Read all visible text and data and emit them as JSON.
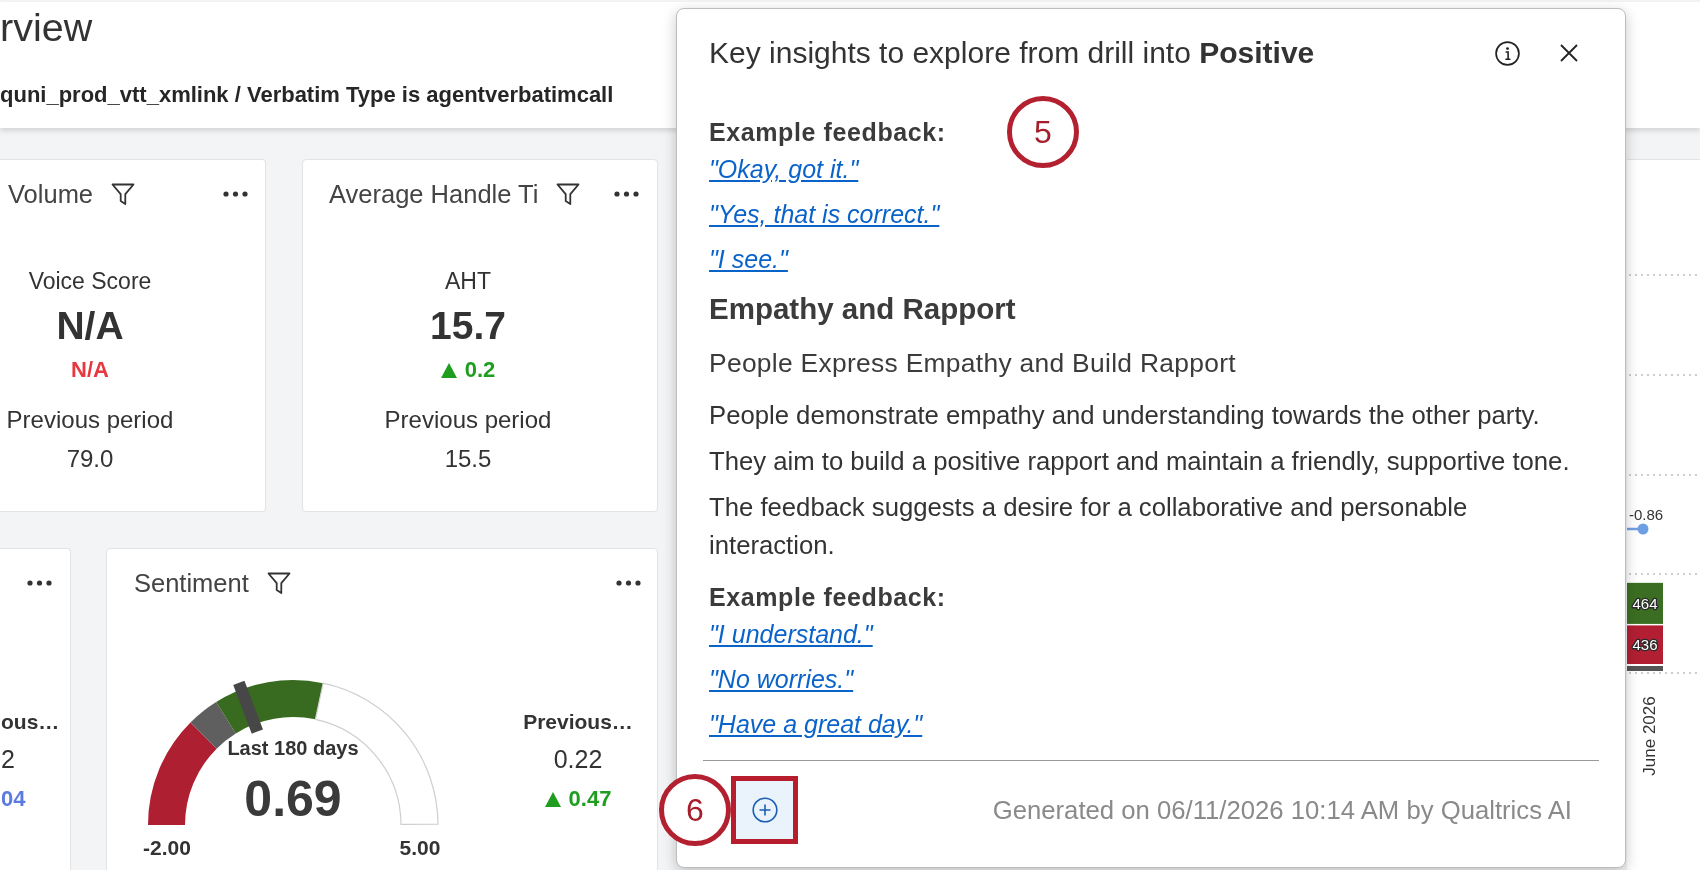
{
  "header": {
    "title": "rview",
    "subtitle": "quni_prod_vtt_xmlink / Verbatim Type is agentverbatimcall"
  },
  "widgets": [
    {
      "kind": "metric",
      "title": "Volume",
      "metric_label": "Voice Score",
      "value": "N/A",
      "change": {
        "text": "N/A",
        "up": false,
        "color": "#e5393f"
      },
      "previous_label": "Previous period",
      "previous_value": "79.0"
    },
    {
      "kind": "metric",
      "title": "Average Handle Ti",
      "metric_label": "AHT",
      "value": "15.7",
      "change": {
        "text": "0.2",
        "up": true,
        "color": "#1f9d1f"
      },
      "previous_label": "Previous period",
      "previous_value": "15.5"
    },
    {
      "kind": "comparison",
      "previous_label": "ous…",
      "previous_value": "2",
      "change": {
        "text": "04",
        "up": false,
        "color": "#5b7be0"
      }
    },
    {
      "kind": "gauge",
      "title": "Sentiment",
      "gauge": {
        "caption": "Last 180 days",
        "value": "0.69",
        "level": 0.384,
        "min_label": "-2.00",
        "max_label": "5.00"
      },
      "previous_label": "Previous…",
      "previous_value": "0.22",
      "change": {
        "text": "0.47",
        "up": true,
        "color": "#1f9d1f"
      }
    }
  ],
  "trend_chart": {
    "point_label": "-0.86",
    "chart_data": {
      "type": "bar",
      "stacked": true,
      "categories": [
        "June 2026"
      ],
      "series": [
        {
          "color": "#b21f33",
          "values": [
            436
          ]
        },
        {
          "color": "#3b6e22",
          "values": [
            464
          ]
        }
      ],
      "data_labels": true
    }
  },
  "insights_panel": {
    "title": "Key insights to explore from drill into **Positive**",
    "sections": [
      {
        "kind": "examples",
        "heading": "Example feedback:",
        "callout": "5",
        "quotes": [
          "\"Okay, got it.\"",
          "\"Yes, that is correct.\"",
          "\"I see.\""
        ]
      },
      {
        "kind": "theme",
        "heading": "Empathy and Rapport",
        "subheading": "People Express Empathy and Build Rapport",
        "paragraphs": [
          "People demonstrate empathy and understanding towards the other party.",
          "They aim to build a positive rapport and maintain a friendly, supportive tone.",
          "The feedback suggests a desire for a collaborative and personable interaction."
        ]
      },
      {
        "kind": "examples",
        "heading": "Example feedback:",
        "quotes": [
          "\"I understand.\"",
          "\"No worries.\"",
          "\"Have a great day.\""
        ]
      }
    ],
    "footer": {
      "callout": "6",
      "add_highlighted": true,
      "generated": "Generated on 06/11/2026 10:14 AM by Qualtrics AI"
    }
  }
}
